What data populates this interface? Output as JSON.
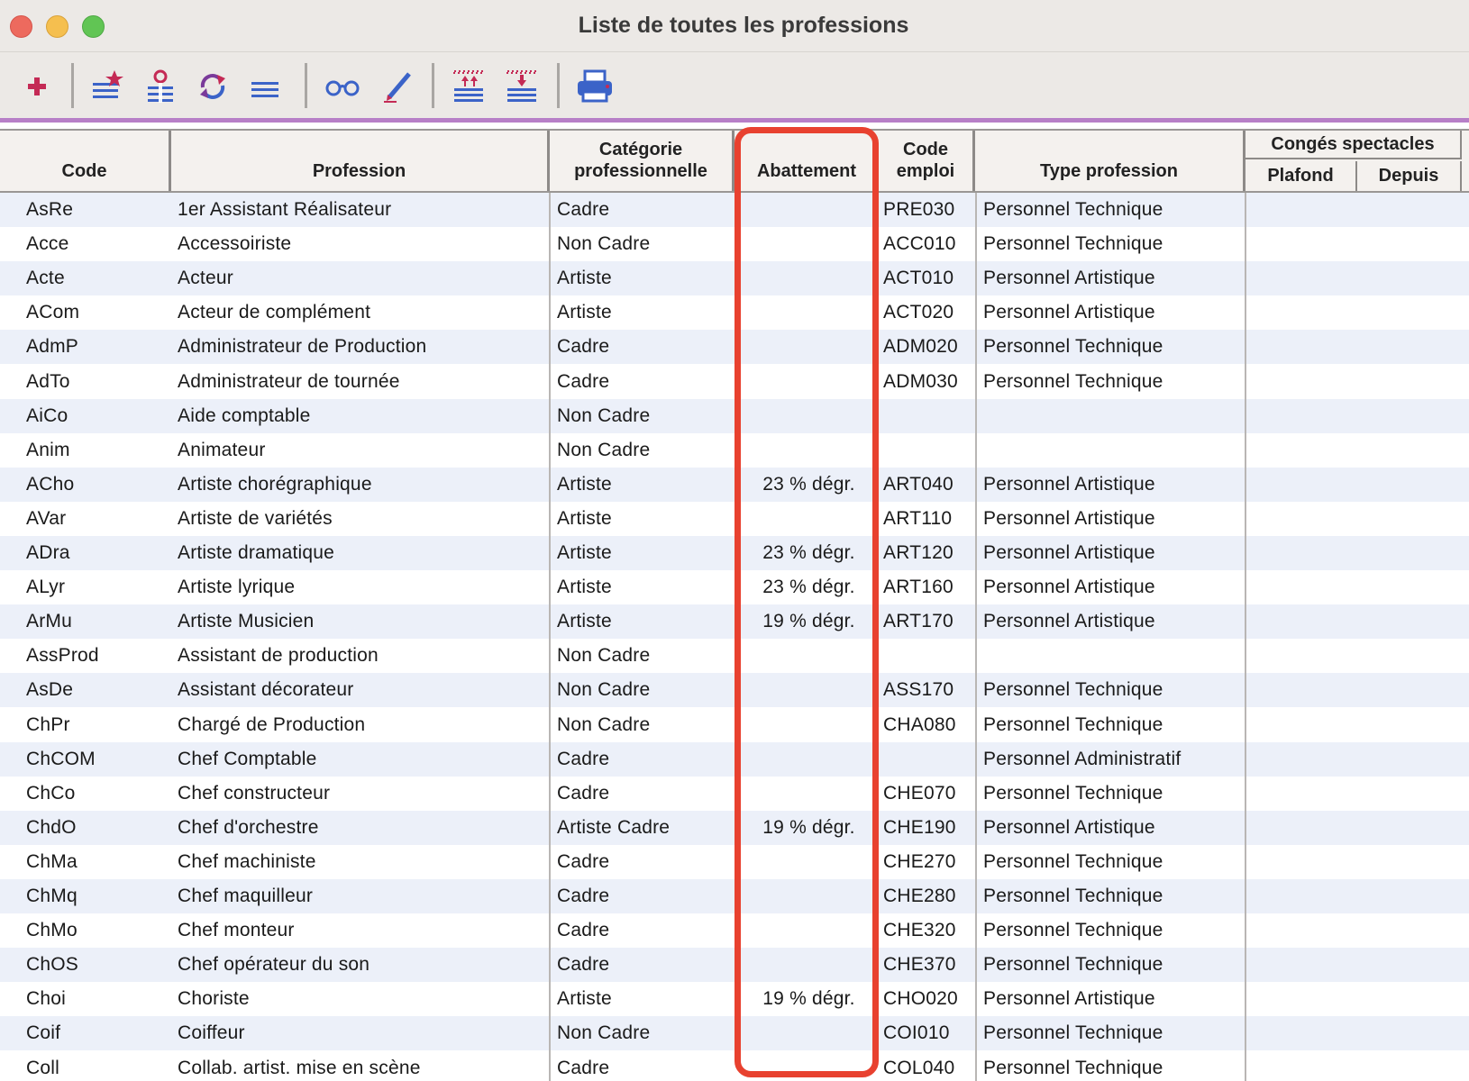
{
  "window": {
    "title": "Liste de toutes les professions"
  },
  "toolbar": {
    "buttons": [
      {
        "name": "add-icon"
      },
      {
        "name": "list-star-icon"
      },
      {
        "name": "list-person-icon"
      },
      {
        "name": "refresh-icon"
      },
      {
        "name": "list-icon"
      },
      {
        "name": "glasses-icon"
      },
      {
        "name": "pencil-icon"
      },
      {
        "name": "import-icon"
      },
      {
        "name": "export-icon"
      },
      {
        "name": "printer-icon"
      }
    ]
  },
  "table": {
    "headers": {
      "code": "Code",
      "profession": "Profession",
      "categorie_line1": "Catégorie",
      "categorie_line2": "professionnelle",
      "abattement": "Abattement",
      "code_emploi_line1": "Code",
      "code_emploi_line2": "emploi",
      "type": "Type profession",
      "conges": "Congés spectacles",
      "plafond": "Plafond",
      "depuis": "Depuis"
    },
    "rows": [
      [
        "AsRe",
        "1er Assistant Réalisateur",
        "Cadre",
        "",
        "PRE030",
        "Personnel Technique"
      ],
      [
        "Acce",
        "Accessoiriste",
        "Non Cadre",
        "",
        "ACC010",
        "Personnel Technique"
      ],
      [
        "Acte",
        "Acteur",
        "Artiste",
        "",
        "ACT010",
        "Personnel Artistique"
      ],
      [
        "ACom",
        "Acteur de complément",
        "Artiste",
        "",
        "ACT020",
        "Personnel Artistique"
      ],
      [
        "AdmP",
        "Administrateur de Production",
        "Cadre",
        "",
        "ADM020",
        "Personnel Technique"
      ],
      [
        "AdTo",
        "Administrateur de tournée",
        "Cadre",
        "",
        "ADM030",
        "Personnel Technique"
      ],
      [
        "AiCo",
        "Aide comptable",
        "Non Cadre",
        "",
        "",
        ""
      ],
      [
        "Anim",
        "Animateur",
        "Non Cadre",
        "",
        "",
        ""
      ],
      [
        "ACho",
        "Artiste chorégraphique",
        "Artiste",
        "23 % dégr.",
        "ART040",
        "Personnel Artistique"
      ],
      [
        "AVar",
        "Artiste de variétés",
        "Artiste",
        "",
        "ART110",
        "Personnel Artistique"
      ],
      [
        "ADra",
        "Artiste dramatique",
        "Artiste",
        "23 % dégr.",
        "ART120",
        "Personnel Artistique"
      ],
      [
        "ALyr",
        "Artiste lyrique",
        "Artiste",
        "23 % dégr.",
        "ART160",
        "Personnel Artistique"
      ],
      [
        "ArMu",
        "Artiste Musicien",
        "Artiste",
        "19 % dégr.",
        "ART170",
        "Personnel Artistique"
      ],
      [
        "AssProd",
        "Assistant de production",
        "Non Cadre",
        "",
        "",
        ""
      ],
      [
        "AsDe",
        "Assistant décorateur",
        "Non Cadre",
        "",
        "ASS170",
        "Personnel Technique"
      ],
      [
        "ChPr",
        "Chargé de Production",
        "Non Cadre",
        "",
        "CHA080",
        "Personnel Technique"
      ],
      [
        "ChCOM",
        "Chef Comptable",
        "Cadre",
        "",
        "",
        "Personnel Administratif"
      ],
      [
        "ChCo",
        "Chef constructeur",
        "Cadre",
        "",
        "CHE070",
        "Personnel Technique"
      ],
      [
        "ChdO",
        "Chef d'orchestre",
        "Artiste Cadre",
        "19 % dégr.",
        "CHE190",
        "Personnel Artistique"
      ],
      [
        "ChMa",
        "Chef machiniste",
        "Cadre",
        "",
        "CHE270",
        "Personnel Technique"
      ],
      [
        "ChMq",
        "Chef maquilleur",
        "Cadre",
        "",
        "CHE280",
        "Personnel Technique"
      ],
      [
        "ChMo",
        "Chef monteur",
        "Cadre",
        "",
        "CHE320",
        "Personnel Technique"
      ],
      [
        "ChOS",
        "Chef opérateur du son",
        "Cadre",
        "",
        "CHE370",
        "Personnel Technique"
      ],
      [
        "Choi",
        "Choriste",
        "Artiste",
        "19 % dégr.",
        "CHO020",
        "Personnel Artistique"
      ],
      [
        "Coif",
        "Coiffeur",
        "Non Cadre",
        "",
        "COI010",
        "Personnel Technique"
      ],
      [
        "Coll",
        "Collab. artist. mise en scène",
        "Cadre",
        "",
        "COL040",
        "Personnel Technique"
      ]
    ]
  },
  "colors": {
    "accent_bar": "#b77fc7",
    "highlight": "#e8412f",
    "row_alt": "#ecf0f9"
  }
}
